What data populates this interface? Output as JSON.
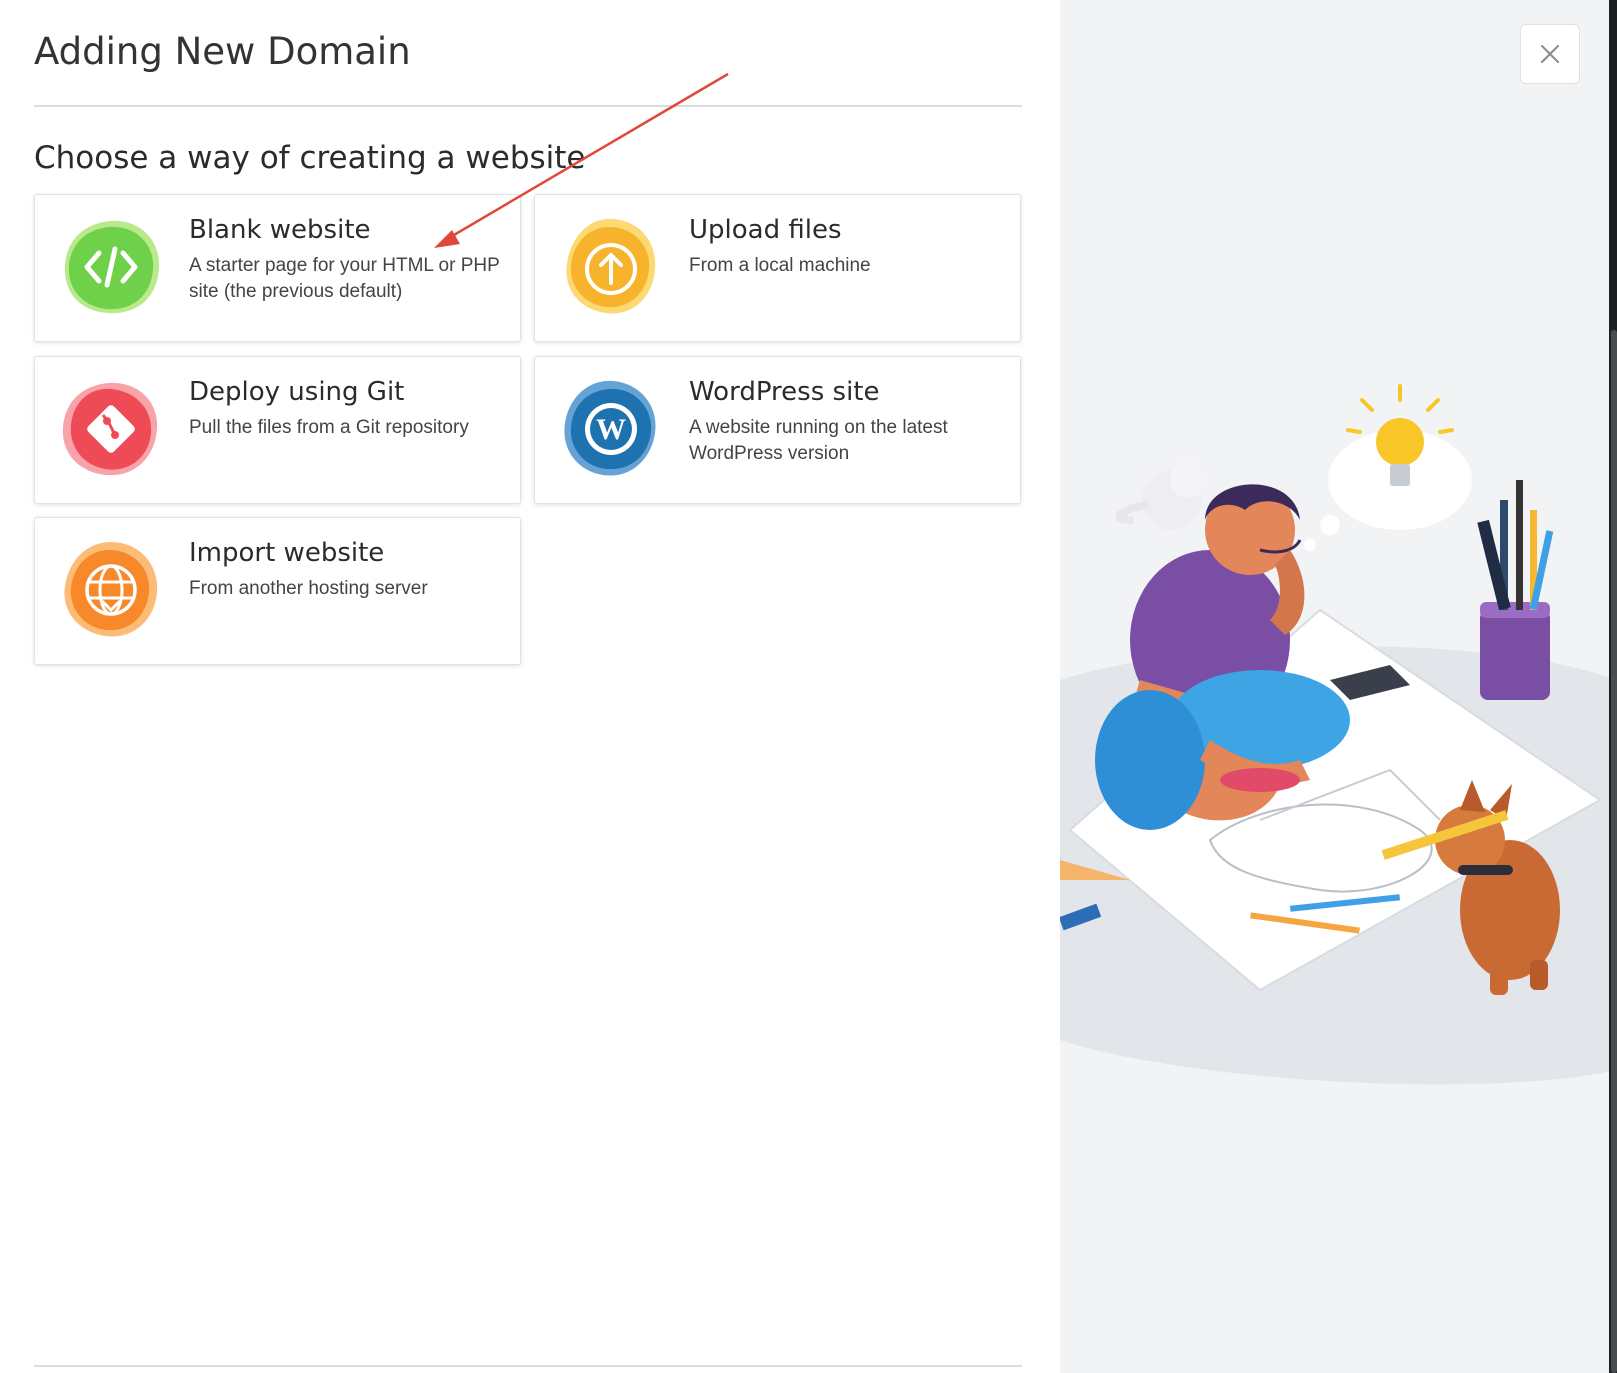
{
  "dialog": {
    "title": "Adding New Domain",
    "close_label": "Close"
  },
  "section": {
    "title": "Choose a way of creating a website"
  },
  "options": [
    {
      "title": "Blank website",
      "description": "A starter page for your HTML or PHP site (the previous default)",
      "icon": "code-icon",
      "color": "#7ed957"
    },
    {
      "title": "Upload files",
      "description": "From a local machine",
      "icon": "upload-arrow-icon",
      "color": "#f9b833"
    },
    {
      "title": "Deploy using Git",
      "description": "Pull the files from a Git repository",
      "icon": "git-icon",
      "color": "#f0555f"
    },
    {
      "title": "WordPress site",
      "description": "A website running on the latest WordPress version",
      "icon": "wordpress-icon",
      "color": "#1f77b4"
    },
    {
      "title": "Import website",
      "description": "From another hosting server",
      "icon": "globe-import-icon",
      "color": "#fb8c2e"
    }
  ],
  "annotation": {
    "arrow_color": "#e0483b"
  }
}
